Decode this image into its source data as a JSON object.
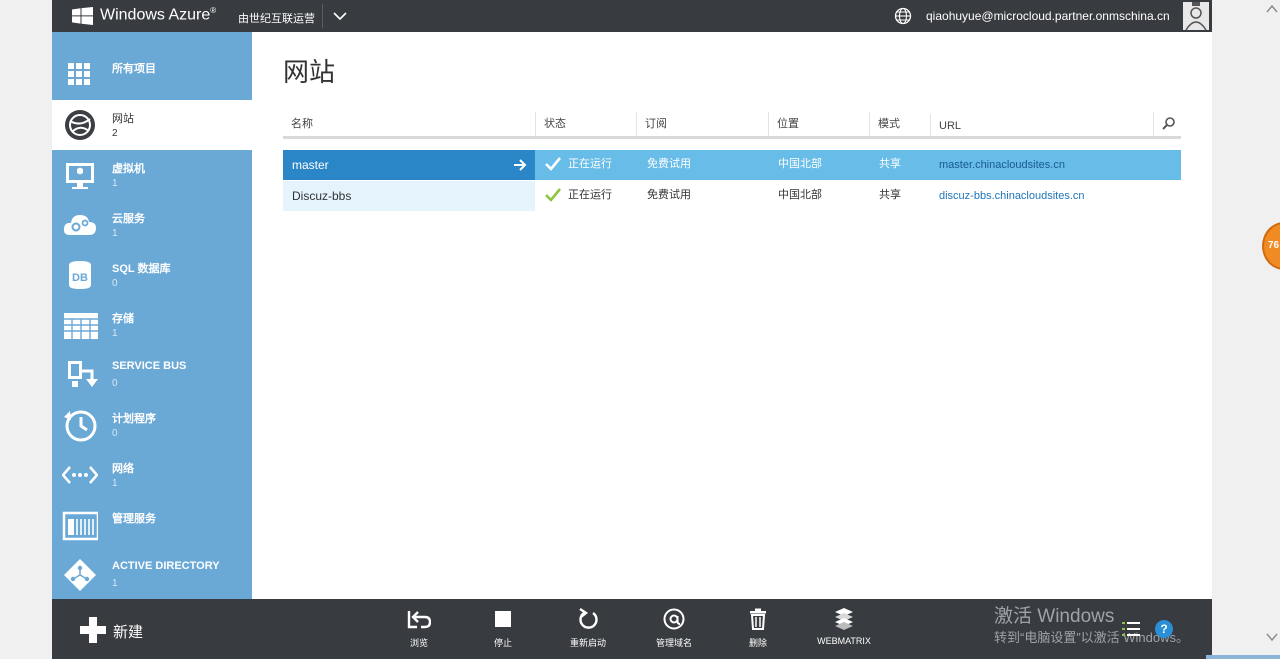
{
  "topbar": {
    "brand": "Windows Azure",
    "brand_mark": "®",
    "subscription": "由世纪互联运营",
    "user_email": "qiaohuyue@microcloud.partner.onmschina.cn"
  },
  "sidebar": {
    "items": [
      {
        "label": "所有项目",
        "count": "",
        "icon": "grid-icon"
      },
      {
        "label": "网站",
        "count": "2",
        "icon": "website-icon"
      },
      {
        "label": "虚拟机",
        "count": "1",
        "icon": "monitor-icon"
      },
      {
        "label": "云服务",
        "count": "1",
        "icon": "cloud-gear-icon"
      },
      {
        "label": "SQL 数据库",
        "count": "0",
        "icon": "database-icon"
      },
      {
        "label": "存储",
        "count": "1",
        "icon": "storage-table-icon"
      },
      {
        "label": "SERVICE BUS",
        "count": "0",
        "icon": "service-bus-icon"
      },
      {
        "label": "计划程序",
        "count": "0",
        "icon": "clock-icon"
      },
      {
        "label": "网络",
        "count": "1",
        "icon": "network-icon"
      },
      {
        "label": "管理服务",
        "count": "",
        "icon": "management-icon"
      },
      {
        "label": "ACTIVE DIRECTORY",
        "count": "1",
        "icon": "directory-icon"
      }
    ]
  },
  "main": {
    "title": "网站",
    "columns": {
      "name": "名称",
      "status": "状态",
      "subscription": "订阅",
      "location": "位置",
      "mode": "模式",
      "url": "URL"
    },
    "rows": [
      {
        "name": "master",
        "status": "正在运行",
        "subscription": "免费试用",
        "location": "中国北部",
        "mode": "共享",
        "url": "master.chinacloudsites.cn"
      },
      {
        "name": "Discuz-bbs",
        "status": "正在运行",
        "subscription": "免费试用",
        "location": "中国北部",
        "mode": "共享",
        "url": "discuz-bbs.chinacloudsites.cn"
      }
    ]
  },
  "bottombar": {
    "new_label": "新建",
    "commands": [
      {
        "label": "浏览"
      },
      {
        "label": "停止"
      },
      {
        "label": "重新启动"
      },
      {
        "label": "管理域名"
      },
      {
        "label": "删除"
      },
      {
        "label": "WEBMATRIX"
      }
    ],
    "help": "?"
  },
  "overlay": {
    "activate_title": "激活 Windows",
    "activate_text": "转到“电脑设置”以激活 Windows。",
    "badge": "76"
  },
  "colors": {
    "topbar": "#383b3f",
    "sidebar": "#6aa8d6",
    "selected_row": "#67bce8",
    "selected_name": "#2a86c6",
    "check": "#8cc63f"
  }
}
